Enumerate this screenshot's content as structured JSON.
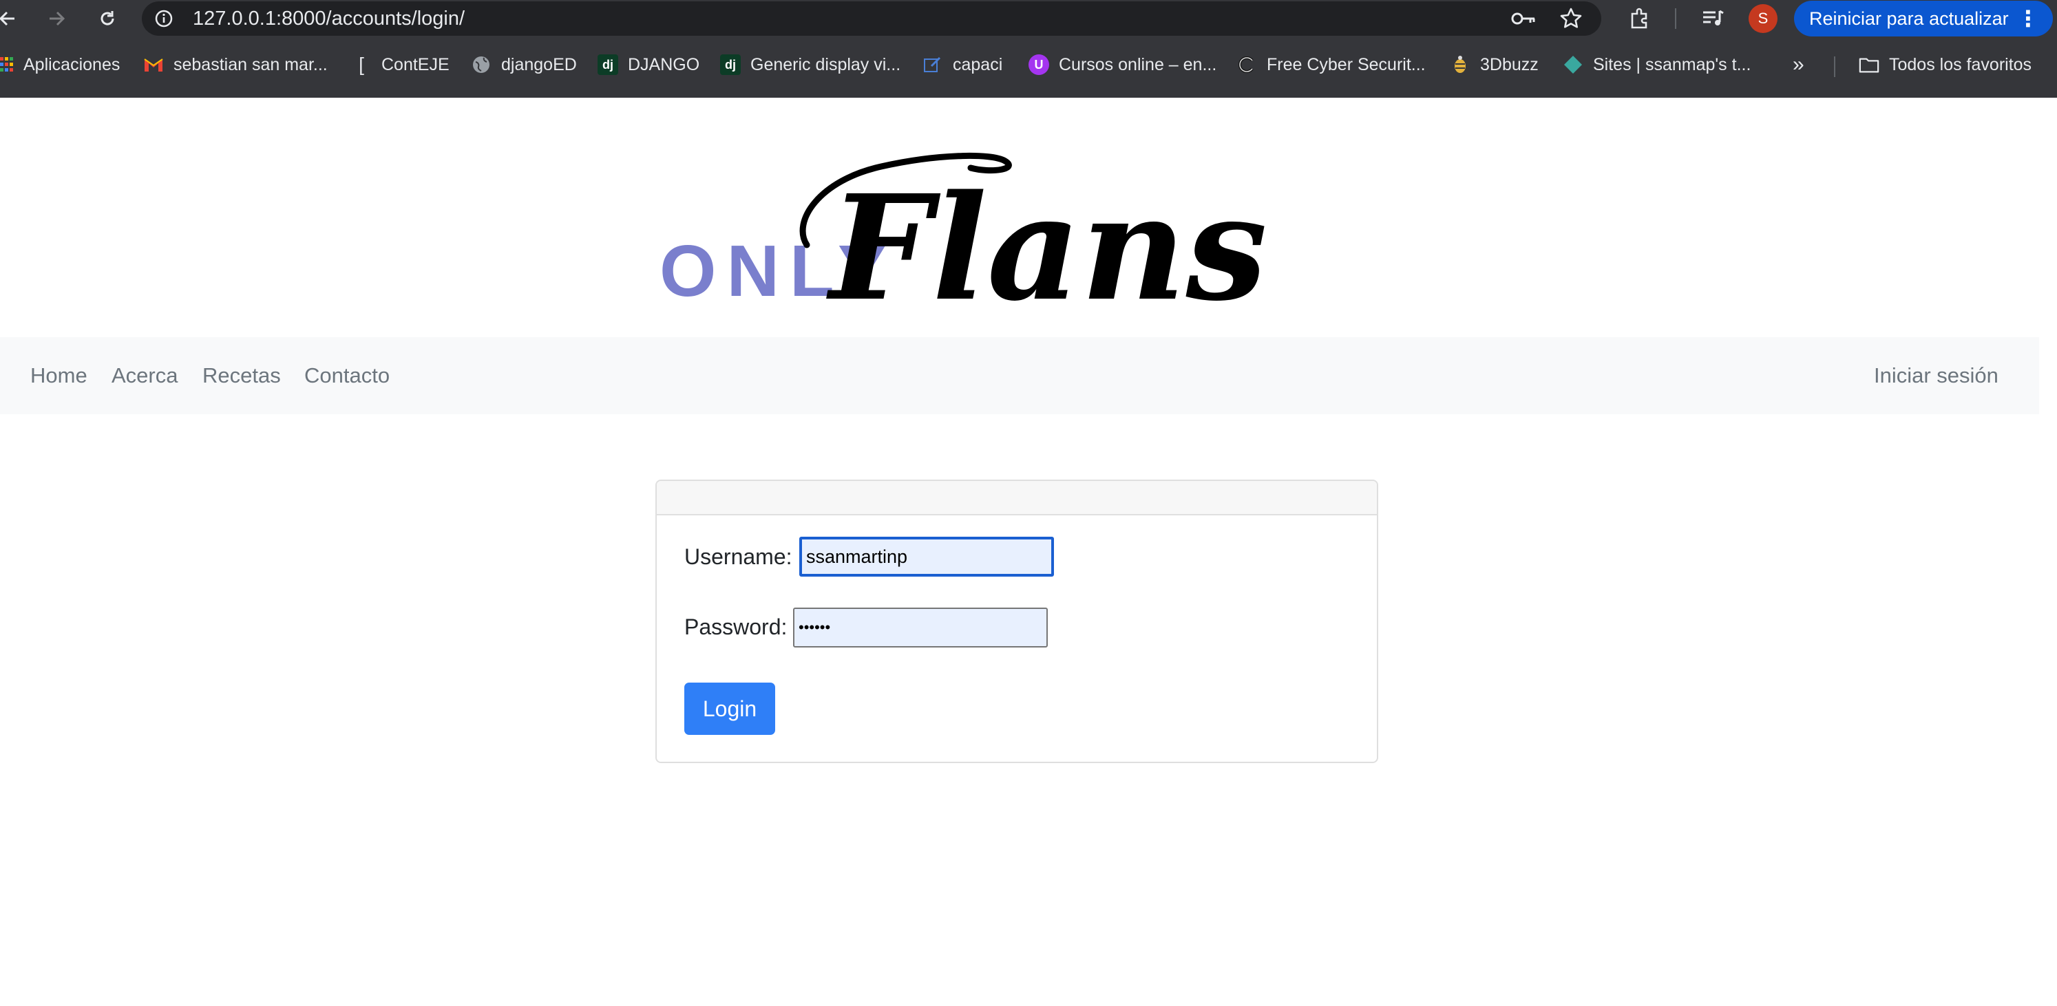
{
  "browser": {
    "url": "127.0.0.1:8000/accounts/login/",
    "avatar_letter": "S",
    "update_button": "Reiniciar para actualizar",
    "bookmarks": [
      {
        "label": "Aplicaciones",
        "icon": "apps-grid-icon"
      },
      {
        "label": "sebastian san mar...",
        "icon": "gmail-icon"
      },
      {
        "label": "ContEJE",
        "icon": "bracket-icon"
      },
      {
        "label": "djangoED",
        "icon": "globe-icon"
      },
      {
        "label": "DJANGO",
        "icon": "django-icon"
      },
      {
        "label": "Generic display vi...",
        "icon": "django-icon"
      },
      {
        "label": "capaci",
        "icon": "edit-icon"
      },
      {
        "label": "Cursos online – en...",
        "icon": "udemy-icon"
      },
      {
        "label": "Free Cyber Securit...",
        "icon": "shell-icon"
      },
      {
        "label": "3Dbuzz",
        "icon": "buzz-icon"
      },
      {
        "label": "Sites | ssanmap's t...",
        "icon": "sites-icon"
      }
    ],
    "all_bookmarks": "Todos los favoritos"
  },
  "logo": {
    "word1": "ONLY",
    "word2": "Flans",
    "word1_color": "#7a7fcd",
    "word2_color": "#000000"
  },
  "nav": {
    "links": [
      "Home",
      "Acerca",
      "Recetas",
      "Contacto"
    ],
    "login": "Iniciar sesión"
  },
  "form": {
    "username_label": "Username:",
    "username_value": "ssanmartinp",
    "password_label": "Password:",
    "password_value": "••••••",
    "submit": "Login"
  },
  "colors": {
    "chrome_bg": "#35363a",
    "navbar_bg": "#f8f9fa",
    "primary": "#2f7ff7",
    "update_button_bg": "#0b57d0"
  }
}
